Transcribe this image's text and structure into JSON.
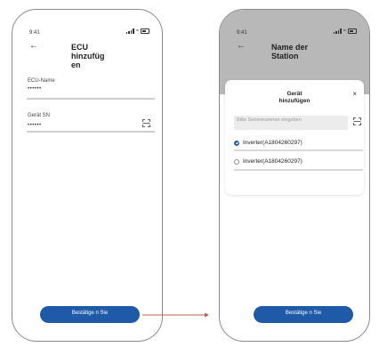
{
  "left_screen": {
    "status_time": "9:41",
    "title": "ECU hinzufüg en",
    "fields": [
      {
        "label": "ECU-Name",
        "value": "••••••"
      },
      {
        "label": "Gerät SN",
        "value": "••••••"
      }
    ],
    "confirm_label": "Bestätige n Sie"
  },
  "right_screen": {
    "status_time": "9:41",
    "title": "Name der Station",
    "modal": {
      "title": "Gerät hinzufügen",
      "close_symbol": "×",
      "serial_placeholder": "Bitte Seriennummer eingeben",
      "devices": [
        {
          "label": "Inverter(A1804260297)",
          "checked": true
        },
        {
          "label": "Inverter(A1804260297)",
          "checked": false
        }
      ]
    },
    "confirm_label": "Bestätige n Sie"
  },
  "icons": [
    "back-arrow-icon",
    "scan-icon",
    "close-icon",
    "signal-icon",
    "wifi-icon",
    "battery-icon"
  ],
  "colors": {
    "primary": "#1e5aa8",
    "arrow": "#b5634f",
    "header_grey": "#b8b8b8"
  }
}
